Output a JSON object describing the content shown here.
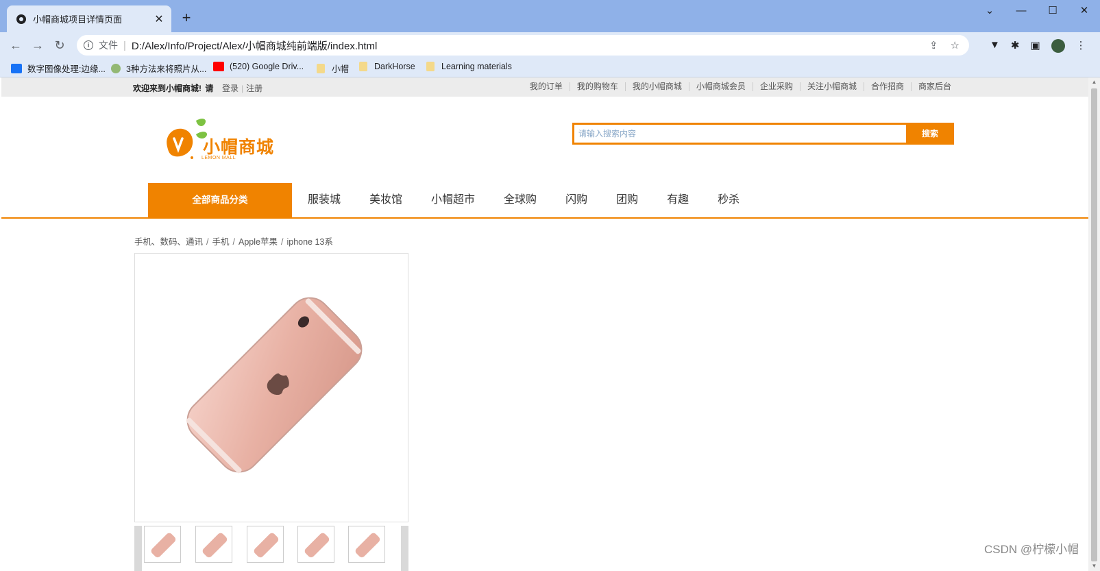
{
  "browser": {
    "tab_title": "小帽商城项目详情页面",
    "tab_close": "✕",
    "new_tab": "+",
    "window_buttons": {
      "minimize": "—",
      "maximize": "☐",
      "close": "✕",
      "dropdown": "⌄"
    },
    "nav": {
      "back": "←",
      "forward": "→",
      "reload": "↻"
    },
    "address": {
      "scheme_label": "文件",
      "separator": "|",
      "url": "D:/Alex/Info/Project/Alex/小帽商城纯前端版/index.html"
    },
    "bookmarks": [
      {
        "label": "数字图像处理:边缘...",
        "icon": "zhihu-icon",
        "color": "#1772f6"
      },
      {
        "label": "3种方法来将照片从...",
        "icon": "wikihow-icon",
        "color": "#93b874"
      },
      {
        "label": "(520) Google Driv...",
        "icon": "youtube-icon",
        "color": "#ff0000"
      },
      {
        "label": "小帽",
        "icon": "folder-icon",
        "color": "#f4d98a"
      },
      {
        "label": "DarkHorse",
        "icon": "folder-icon",
        "color": "#f4d98a"
      },
      {
        "label": "Learning materials",
        "icon": "folder-icon",
        "color": "#f4d98a"
      }
    ]
  },
  "topbar": {
    "welcome": "欢迎来到小帽商城!",
    "please": "请",
    "login": "登录",
    "divider": "|",
    "register": "注册",
    "links": [
      "我的订单",
      "我的购物车",
      "我的小帽商城",
      "小帽商城会员",
      "企业采购",
      "关注小帽商城",
      "合作招商",
      "商家后台"
    ]
  },
  "header": {
    "logo_text": "小帽商城",
    "logo_sub": "LEMON MALL",
    "search_placeholder": "请输入搜索内容",
    "search_button": "搜索"
  },
  "nav": {
    "all_categories": "全部商品分类",
    "items": [
      "服装城",
      "美妆馆",
      "小帽超市",
      "全球购",
      "闪购",
      "团购",
      "有趣",
      "秒杀"
    ]
  },
  "breadcrumb": [
    "手机、数码、通讯",
    "手机",
    "Apple苹果",
    "iphone 13系"
  ],
  "breadcrumb_separator": "/",
  "watermark": "CSDN @柠檬小帽",
  "colors": {
    "accent": "#f08300",
    "chrome": "#8fb1e8",
    "toolbar": "#dfe9f8"
  }
}
